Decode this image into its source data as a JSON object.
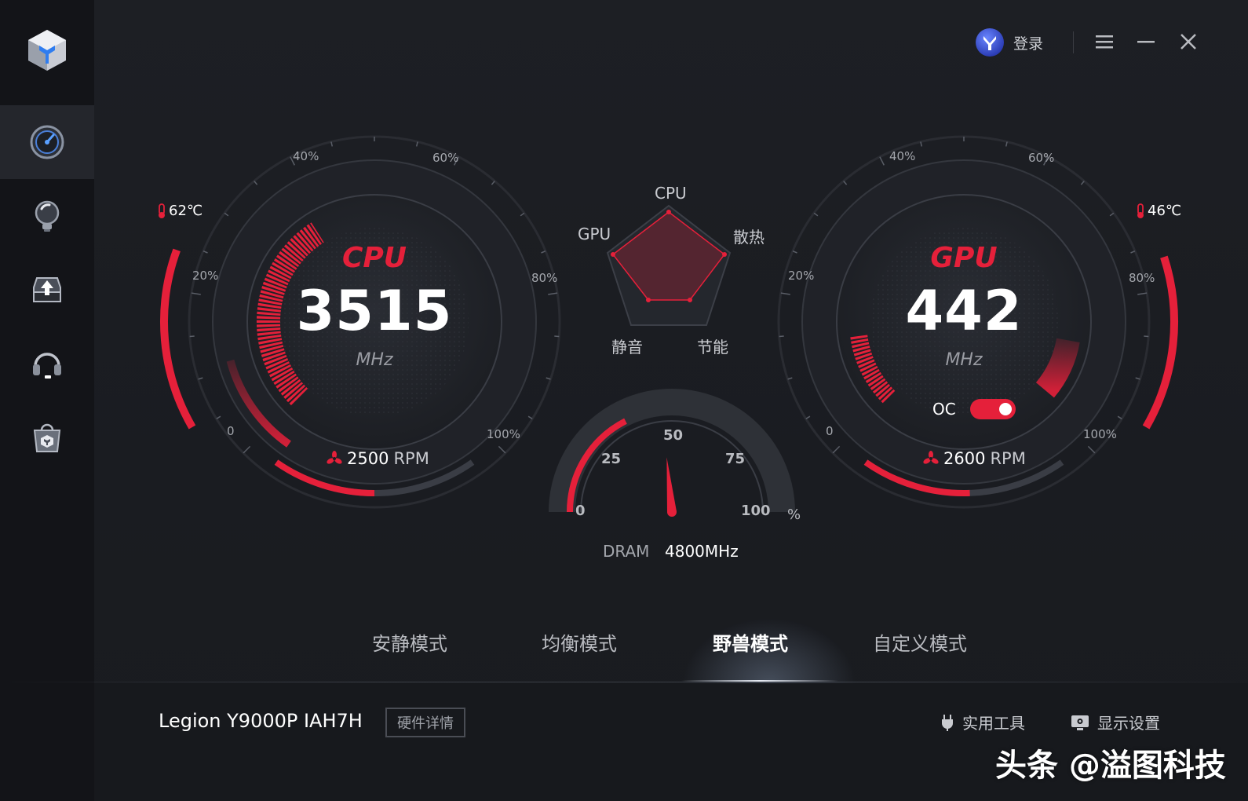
{
  "header": {
    "login_label": "登录"
  },
  "cpu_gauge": {
    "name": "CPU",
    "value": "3515",
    "unit": "MHz",
    "temperature": "62℃",
    "usage_ticks": [
      "0",
      "20%",
      "40%",
      "60%",
      "80%",
      "100%"
    ],
    "fan_value": "2500",
    "fan_unit": "RPM",
    "usage_percent": 38
  },
  "gpu_gauge": {
    "name": "GPU",
    "value": "442",
    "unit": "MHz",
    "temperature": "46℃",
    "usage_ticks": [
      "0",
      "20%",
      "40%",
      "60%",
      "80%",
      "100%"
    ],
    "fan_value": "2600",
    "fan_unit": "RPM",
    "oc_label": "OC",
    "oc_on": true,
    "usage_percent": 14
  },
  "radar": {
    "labels": {
      "top": "CPU",
      "left": "GPU",
      "right": "散热",
      "bottom_left": "静音",
      "bottom_right": "节能"
    }
  },
  "dram": {
    "label": "DRAM",
    "value": "4800MHz",
    "ticks": [
      "0",
      "25",
      "50",
      "75",
      "100"
    ],
    "unit": "%",
    "usage_percent": 47
  },
  "modes": {
    "items": [
      {
        "label": "安静模式",
        "active": false
      },
      {
        "label": "均衡模式",
        "active": false
      },
      {
        "label": "野兽模式",
        "active": true
      },
      {
        "label": "自定义模式",
        "active": false
      }
    ]
  },
  "footer": {
    "model": "Legion Y9000P IAH7H",
    "hw_details_label": "硬件详情",
    "tools_label": "实用工具",
    "display_label": "显示设置"
  },
  "watermark": "头条 @溢图科技",
  "colors": {
    "accent": "#e5203a",
    "background": "#1b1d22",
    "sidebar": "#131418"
  }
}
